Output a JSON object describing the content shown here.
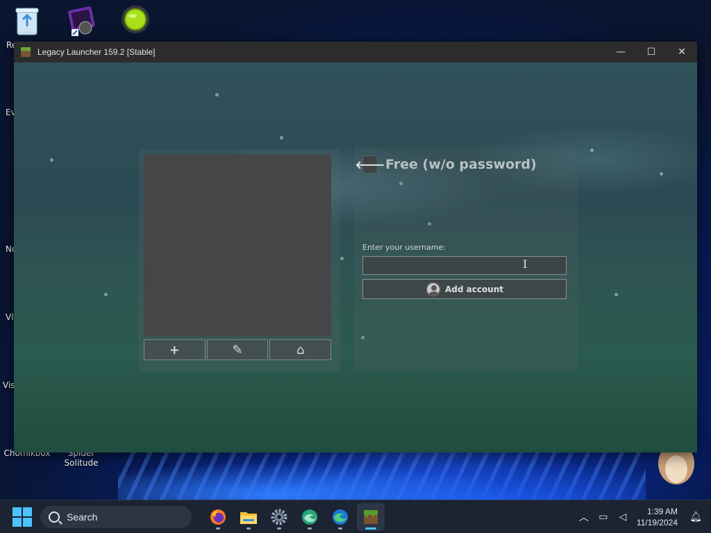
{
  "desktop": {
    "icons": [
      {
        "label": "Re"
      },
      {
        "label": "Ev"
      },
      {
        "label": "Nc"
      },
      {
        "label": "Vl"
      },
      {
        "label": "Vis"
      },
      {
        "label": "Chomikbox"
      },
      {
        "label": "Spider Solitude"
      }
    ]
  },
  "window": {
    "title": "Legacy Launcher 159.2 [Stable]",
    "controls": {
      "minimize": "—",
      "maximize": "☐",
      "close": "✕"
    }
  },
  "launcher": {
    "account_buttons": {
      "add": "+",
      "edit": "✎",
      "home": "⌂"
    },
    "back_label": "🡐",
    "heading": "Free (w/o password)",
    "username_label": "Enter your username:",
    "username_value": "",
    "add_account_label": "Add account"
  },
  "taskbar": {
    "search_placeholder": "Search",
    "apps": [
      "firefox-icon",
      "file-explorer-icon",
      "settings-icon",
      "edge-dev-icon",
      "edge-icon",
      "minecraft-launcher-icon"
    ],
    "time": "1:39 AM",
    "date": "11/19/2024"
  },
  "colors": {
    "accent": "#4cc2ff",
    "panel": "#454648"
  }
}
